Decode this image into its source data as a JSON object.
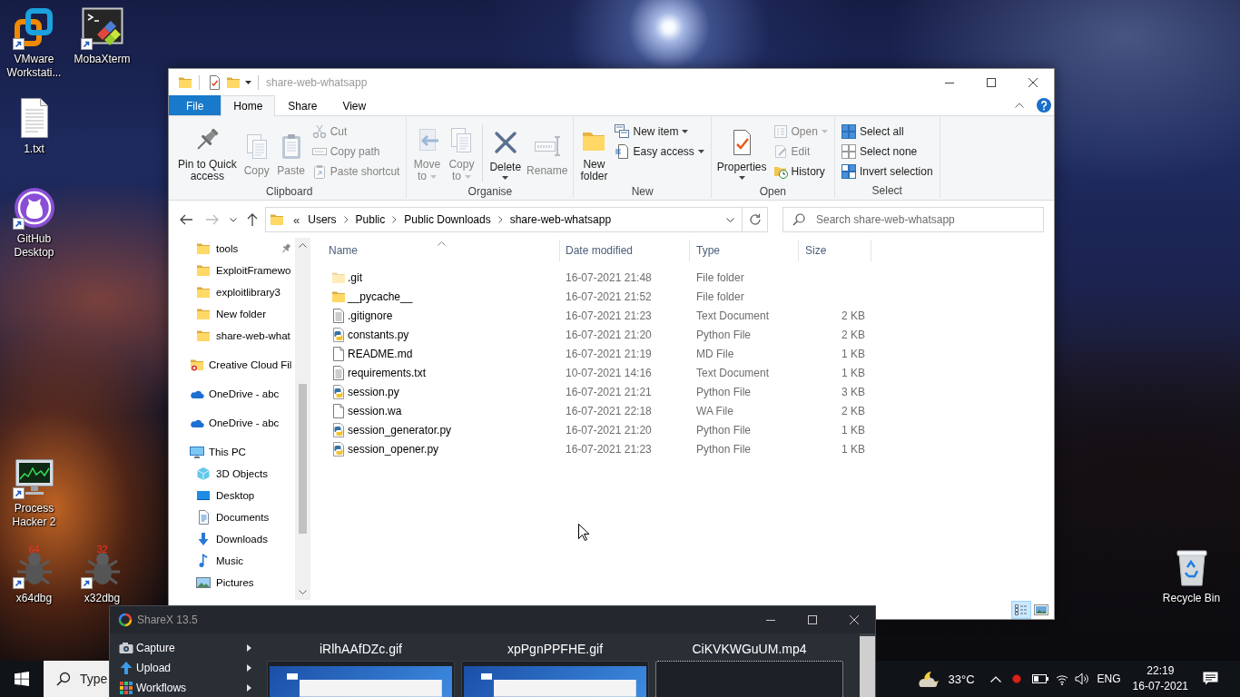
{
  "desktop": {
    "icons": [
      {
        "label": "VMware Workstati...",
        "kind": "vmware",
        "shortcut": true
      },
      {
        "label": "MobaXterm",
        "kind": "mobaxterm",
        "shortcut": true
      },
      {
        "label": "1.txt",
        "kind": "text-file",
        "shortcut": false
      },
      {
        "label": "GitHub Desktop",
        "kind": "github",
        "shortcut": true
      },
      {
        "label": "Process Hacker 2",
        "kind": "process-hacker",
        "shortcut": true
      },
      {
        "label": "x64dbg",
        "kind": "debugger",
        "badge": "64",
        "shortcut": true
      },
      {
        "label": "x32dbg",
        "kind": "debugger",
        "badge": "32",
        "shortcut": true
      },
      {
        "label": "Recycle Bin",
        "kind": "recycle-bin",
        "shortcut": false
      }
    ]
  },
  "explorer": {
    "title": "share-web-whatsapp",
    "ribbon": {
      "tabs": [
        {
          "label": "File",
          "kind": "menu",
          "selected": false
        },
        {
          "label": "Home",
          "kind": "tab",
          "selected": true
        },
        {
          "label": "Share",
          "kind": "tab",
          "selected": false
        },
        {
          "label": "View",
          "kind": "tab",
          "selected": false
        }
      ],
      "groups": [
        {
          "label": "Clipboard",
          "items": [
            {
              "kind": "large",
              "label": "Pin to Quick\naccess",
              "disabled": false,
              "dropdown": false
            },
            {
              "kind": "large",
              "label": "Copy",
              "disabled": true,
              "dropdown": false
            },
            {
              "kind": "large",
              "label": "Paste",
              "disabled": true,
              "dropdown": false
            },
            {
              "kind": "stack",
              "items": [
                {
                  "label": "Cut",
                  "disabled": true,
                  "dropdown": false
                },
                {
                  "label": "Copy path",
                  "disabled": true,
                  "dropdown": false
                },
                {
                  "label": "Paste shortcut",
                  "disabled": true,
                  "dropdown": false
                }
              ]
            }
          ]
        },
        {
          "label": "Organise",
          "items": [
            {
              "kind": "large",
              "label": "Move\nto",
              "disabled": true,
              "dropdown": true
            },
            {
              "kind": "large",
              "label": "Copy\nto",
              "disabled": true,
              "dropdown": true
            },
            {
              "kind": "separator"
            },
            {
              "kind": "split",
              "label": "Delete",
              "disabled": false,
              "dropdown": true
            },
            {
              "kind": "large",
              "label": "Rename",
              "disabled": true,
              "dropdown": false
            }
          ]
        },
        {
          "label": "New",
          "items": [
            {
              "kind": "large",
              "label": "New\nfolder",
              "disabled": false,
              "dropdown": false
            },
            {
              "kind": "stack",
              "items": [
                {
                  "label": "New item",
                  "disabled": false,
                  "dropdown": true
                },
                {
                  "label": "Easy access",
                  "disabled": false,
                  "dropdown": true
                }
              ]
            }
          ]
        },
        {
          "label": "Open",
          "items": [
            {
              "kind": "split",
              "label": "Properties",
              "disabled": false,
              "dropdown": true
            },
            {
              "kind": "stack",
              "items": [
                {
                  "label": "Open",
                  "disabled": true,
                  "dropdown": true
                },
                {
                  "label": "Edit",
                  "disabled": true,
                  "dropdown": false
                },
                {
                  "label": "History",
                  "disabled": false,
                  "dropdown": false
                }
              ]
            }
          ]
        },
        {
          "label": "Select",
          "items": [
            {
              "kind": "stack",
              "items": [
                {
                  "label": "Select all",
                  "disabled": false,
                  "dropdown": false
                },
                {
                  "label": "Select none",
                  "disabled": false,
                  "dropdown": false
                },
                {
                  "label": "Invert selection",
                  "disabled": false,
                  "dropdown": false
                }
              ]
            }
          ]
        }
      ]
    },
    "address_bar": {
      "nav_buttons": [
        {
          "kind": "back",
          "disabled": false
        },
        {
          "kind": "forward",
          "disabled": true
        },
        {
          "kind": "recent",
          "disabled": false
        },
        {
          "kind": "up",
          "disabled": false
        }
      ],
      "overflow": "«",
      "breadcrumbs": [
        "Users",
        "Public",
        "Public Downloads",
        "share-web-whatsapp"
      ]
    },
    "search": {
      "placeholder": "Search share-web-whatsapp"
    },
    "nav_pane": {
      "quick_access": [
        {
          "label": "tools",
          "pinned": true
        },
        {
          "label": "ExploitFramewo",
          "pinned": false
        },
        {
          "label": "exploitlibrary3",
          "pinned": false
        },
        {
          "label": "New folder",
          "pinned": false
        },
        {
          "label": "share-web-what",
          "pinned": false
        }
      ],
      "items": [
        {
          "label": "Creative Cloud Fil",
          "kind": "creativecloud"
        },
        {
          "label": "OneDrive - abc",
          "kind": "onedrive"
        },
        {
          "label": "OneDrive - abc",
          "kind": "onedrive"
        },
        {
          "label": "This PC",
          "kind": "pc",
          "children": [
            {
              "label": "3D Objects",
              "kind": "objects"
            },
            {
              "label": "Desktop",
              "kind": "desktop"
            },
            {
              "label": "Documents",
              "kind": "documents"
            },
            {
              "label": "Downloads",
              "kind": "downloads"
            },
            {
              "label": "Music",
              "kind": "music"
            },
            {
              "label": "Pictures",
              "kind": "pictures"
            }
          ]
        }
      ]
    },
    "file_list": {
      "columns": [
        {
          "label": "Name",
          "sorted": true
        },
        {
          "label": "Date modified",
          "sorted": false
        },
        {
          "label": "Type",
          "sorted": false
        },
        {
          "label": "Size",
          "sorted": false
        }
      ],
      "rows": [
        {
          "name": ".git",
          "kind": "folder",
          "hidden": true,
          "date_modified": "16-07-2021 21:48",
          "type": "File folder"
        },
        {
          "name": "__pycache__",
          "kind": "folder",
          "hidden": false,
          "date_modified": "16-07-2021 21:52",
          "type": "File folder"
        },
        {
          "name": ".gitignore",
          "kind": "text",
          "hidden": false,
          "date_modified": "16-07-2021 21:23",
          "type": "Text Document",
          "size": "2 KB"
        },
        {
          "name": "constants.py",
          "kind": "python",
          "hidden": false,
          "date_modified": "16-07-2021 21:20",
          "type": "Python File",
          "size": "2 KB"
        },
        {
          "name": "README.md",
          "kind": "file",
          "hidden": false,
          "date_modified": "16-07-2021 21:19",
          "type": "MD File",
          "size": "1 KB"
        },
        {
          "name": "requirements.txt",
          "kind": "text",
          "hidden": false,
          "date_modified": "10-07-2021 14:16",
          "type": "Text Document",
          "size": "1 KB"
        },
        {
          "name": "session.py",
          "kind": "python",
          "hidden": false,
          "date_modified": "16-07-2021 21:21",
          "type": "Python File",
          "size": "3 KB"
        },
        {
          "name": "session.wa",
          "kind": "file",
          "hidden": false,
          "date_modified": "16-07-2021 22:18",
          "type": "WA File",
          "size": "2 KB"
        },
        {
          "name": "session_generator.py",
          "kind": "python",
          "hidden": false,
          "date_modified": "16-07-2021 21:20",
          "type": "Python File",
          "size": "1 KB"
        },
        {
          "name": "session_opener.py",
          "kind": "python",
          "hidden": false,
          "date_modified": "16-07-2021 21:23",
          "type": "Python File",
          "size": "1 KB"
        }
      ]
    },
    "status_bar": {
      "views": [
        {
          "kind": "details",
          "selected": true
        },
        {
          "kind": "thumbnails",
          "selected": false
        }
      ]
    }
  },
  "sharex": {
    "title": "ShareX 13.5",
    "menu": [
      {
        "label": "Capture",
        "kind": "capture"
      },
      {
        "label": "Upload",
        "kind": "upload"
      },
      {
        "label": "Workflows",
        "kind": "workflows"
      }
    ],
    "files": [
      {
        "name": "iRlhAAfDZc.gif",
        "kind": "image",
        "selected": false
      },
      {
        "name": "xpPgnPPFHE.gif",
        "kind": "image",
        "selected": false
      },
      {
        "name": "CiKVKWGuUM.mp4",
        "kind": "video",
        "selected": true
      }
    ]
  },
  "taskbar": {
    "search": {
      "placeholder": "Type"
    },
    "weather": {
      "temperature": "33°C"
    },
    "language": "ENG",
    "clock": {
      "time": "22:19",
      "date": "16-07-2021"
    }
  }
}
